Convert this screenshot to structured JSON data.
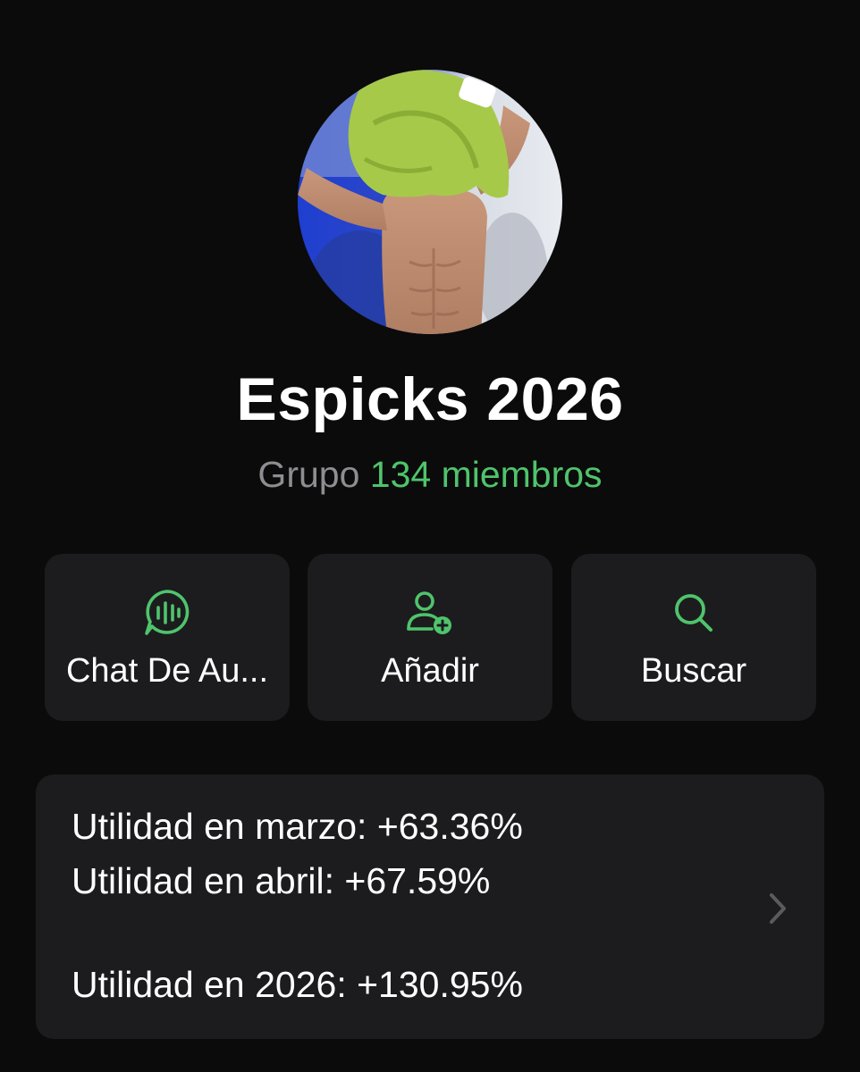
{
  "group": {
    "name": "Espicks 2026",
    "type": "Grupo",
    "members": "134 miembros"
  },
  "actions": [
    {
      "label": "Chat De Au...",
      "icon": "audio-chat-icon"
    },
    {
      "label": "Añadir",
      "icon": "add-user-icon"
    },
    {
      "label": "Buscar",
      "icon": "search-icon"
    }
  ],
  "description": {
    "line1": "Utilidad en marzo: +63.36%",
    "line2": "Utilidad en abril: +67.59%",
    "line3": "Utilidad en 2026: +130.95%"
  },
  "colors": {
    "background": "#0b0b0b",
    "card": "#1c1c1e",
    "accent": "#4fc46c",
    "secondary_text": "#8d8d92"
  }
}
